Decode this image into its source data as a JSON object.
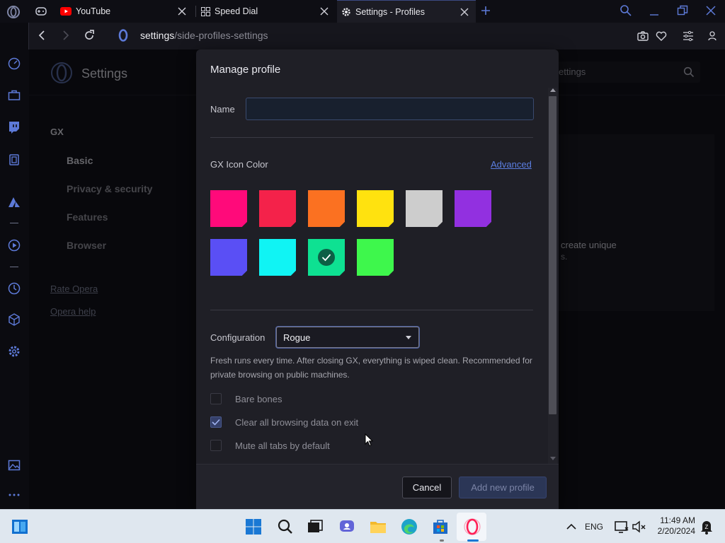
{
  "tabs": [
    {
      "title": "",
      "icon": "gamepad-icon"
    },
    {
      "title": "YouTube",
      "icon": "youtube-icon"
    },
    {
      "title": "Speed Dial",
      "icon": "speed-dial-icon"
    },
    {
      "title": "Settings - Profiles",
      "icon": "gear-icon",
      "active": true
    }
  ],
  "address": {
    "host": "settings",
    "path": "/side-profiles-settings"
  },
  "settings_page": {
    "title": "Settings",
    "search_placeholder": "Search settings",
    "search_visible": "ettings",
    "nav_group": "GX",
    "nav": [
      "Basic",
      "Privacy & security",
      "Features",
      "Browser"
    ],
    "links": [
      "Rate Opera",
      "Opera help"
    ],
    "bg_text_line1": "create unique",
    "bg_text_line2": "s."
  },
  "dialog": {
    "title": "Manage profile",
    "name_label": "Name",
    "name_value": "",
    "color_label": "GX Icon Color",
    "advanced_label": "Advanced",
    "colors": [
      {
        "hex": "#ff0a7a",
        "selected": false
      },
      {
        "hex": "#f4224a",
        "selected": false
      },
      {
        "hex": "#fb7121",
        "selected": false
      },
      {
        "hex": "#ffe20f",
        "selected": false
      },
      {
        "hex": "#cdcdcd",
        "selected": false
      },
      {
        "hex": "#9230e0",
        "selected": false
      },
      {
        "hex": "#5a4ff5",
        "selected": false
      },
      {
        "hex": "#10f4f4",
        "selected": false
      },
      {
        "hex": "#0ee192",
        "selected": true
      },
      {
        "hex": "#3ef74c",
        "selected": false
      }
    ],
    "config_label": "Configuration",
    "config_value": "Rogue",
    "config_description": "Fresh runs every time. After closing GX, everything is wiped clean. Recommended for private browsing on public machines.",
    "options": [
      {
        "label": "Bare bones",
        "checked": false
      },
      {
        "label": "Clear all browsing data on exit",
        "checked": true
      },
      {
        "label": "Mute all tabs by default",
        "checked": false
      }
    ],
    "cancel_label": "Cancel",
    "add_label": "Add new profile"
  },
  "taskbar": {
    "language": "ENG",
    "time": "11:49 AM",
    "date": "2/20/2024"
  }
}
